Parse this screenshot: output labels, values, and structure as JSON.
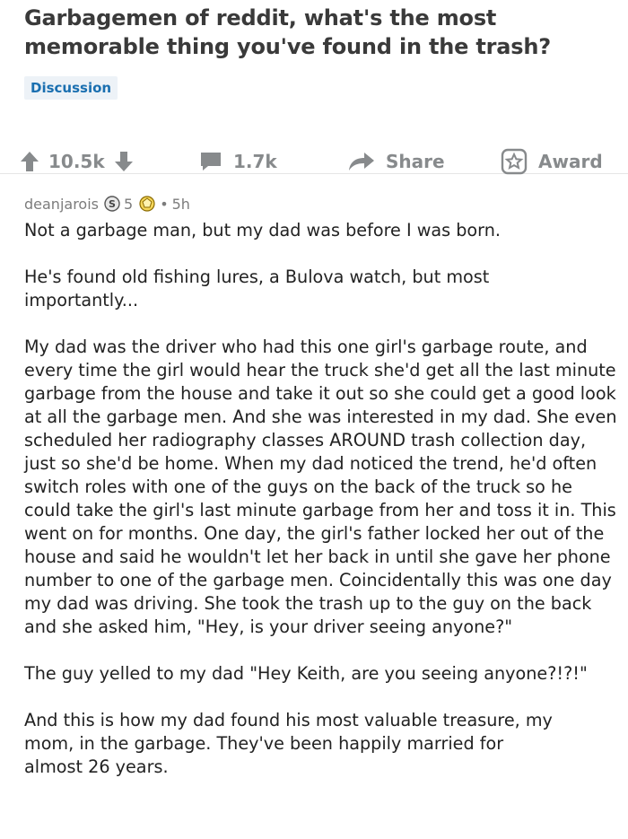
{
  "post": {
    "title": "Garbagemen of reddit, what's the most memorable thing you've found in the trash?",
    "flair": "Discussion",
    "votes": "10.5k",
    "comments": "1.7k",
    "share_label": "Share",
    "award_label": "Award"
  },
  "comment": {
    "author": "deanjarois",
    "award_count": "5",
    "separator": "•",
    "age": "5h",
    "paragraphs": [
      "Not a garbage man, but my dad was before I was born.",
      "He's found old fishing lures, a Bulova watch, but most importantly...",
      "My dad was the driver who had this one girl's garbage route, and every time the girl would hear the truck she'd get all the last minute garbage from the house and take it out so she could get a good look at all the garbage men. And she was interested in my dad. She even scheduled her radiography classes AROUND trash collection day, just so she'd be home. When my dad noticed the trend, he'd often switch roles with one of the guys on the back of the truck so he could take the girl's last minute garbage from her and toss it in. This went on for months. One day, the girl's father locked her out of the house and said he wouldn't let her back in until she gave her phone number to one of the garbage men. Coincidentally this was one day my dad was driving. She took the trash up to the guy on the back and she asked him, \"Hey, is your driver seeing anyone?\"",
      "The guy yelled to my dad \"Hey Keith, are you seeing anyone?!?!\"",
      "And this is how my dad found his most valuable treasure, my mom, in the garbage. They've been happily married for almost 26 years."
    ]
  },
  "icons": [
    "upvote-icon",
    "downvote-icon",
    "comment-icon",
    "share-icon",
    "award-icon",
    "silver-award-icon",
    "gold-award-icon"
  ]
}
